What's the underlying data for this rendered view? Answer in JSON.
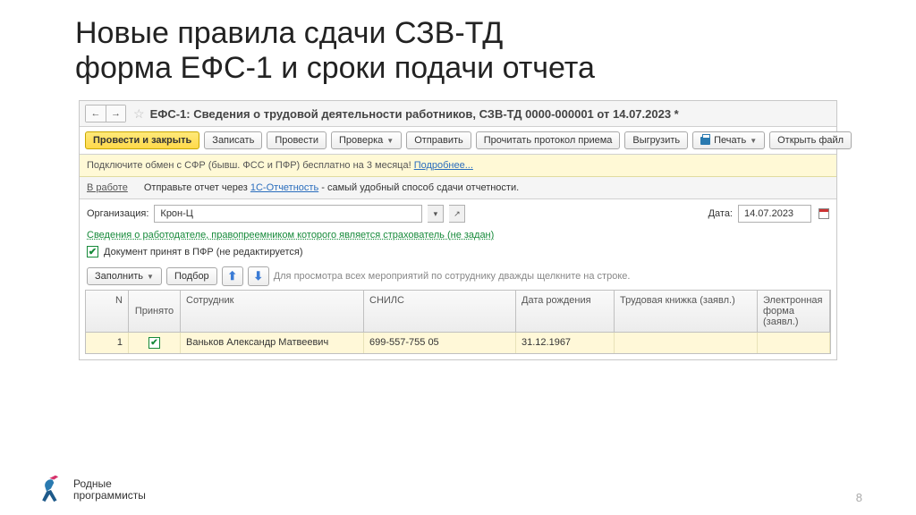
{
  "slide": {
    "title_line1": "Новые правила сдачи СЗВ-ТД",
    "title_line2": "форма ЕФС-1 и сроки подачи отчета",
    "page_number": "8"
  },
  "doc_title": "ЕФС-1: Сведения о трудовой деятельности работников, СЗВ-ТД 0000-000001 от 14.07.2023 *",
  "toolbar": {
    "post_close": "Провести и закрыть",
    "write": "Записать",
    "post": "Провести",
    "check": "Проверка",
    "send": "Отправить",
    "read_protocol": "Прочитать протокол приема",
    "export": "Выгрузить",
    "print": "Печать",
    "open_file": "Открыть файл"
  },
  "info": {
    "text": "Подключите обмен с СФР (бывш. ФСС и ПФР) бесплатно на 3 месяца! ",
    "link": "Подробнее..."
  },
  "status": {
    "label": "В работе",
    "hint_prefix": "Отправьте отчет через ",
    "hint_link": "1С-Отчетность",
    "hint_suffix": " - самый удобный способ сдачи отчетности."
  },
  "form": {
    "org_label": "Организация:",
    "org_value": "Крон-Ц",
    "date_label": "Дата:",
    "date_value": "14.07.2023"
  },
  "successor_link": "Сведения о работодателе, правопреемником которого является страхователь (не задан)",
  "accepted_check": "Документ принят в ПФР (не редактируется)",
  "actions": {
    "fill": "Заполнить",
    "pick": "Подбор",
    "hint": "Для просмотра всех мероприятий по сотруднику дважды щелкните на строке."
  },
  "grid": {
    "headers": {
      "n": "N",
      "accepted": "Принято",
      "employee": "Сотрудник",
      "snils": "СНИЛС",
      "dob": "Дата рождения",
      "tk": "Трудовая книжка (заявл.)",
      "ef": "Электронная форма (заявл.)"
    },
    "row": {
      "n": "1",
      "employee": "Ваньков Александр Матвеевич",
      "snils": "699-557-755 05",
      "dob": "31.12.1967",
      "tk": "",
      "ef": ""
    }
  },
  "footer": {
    "brand_line1": "Родные",
    "brand_line2": "программисты"
  }
}
